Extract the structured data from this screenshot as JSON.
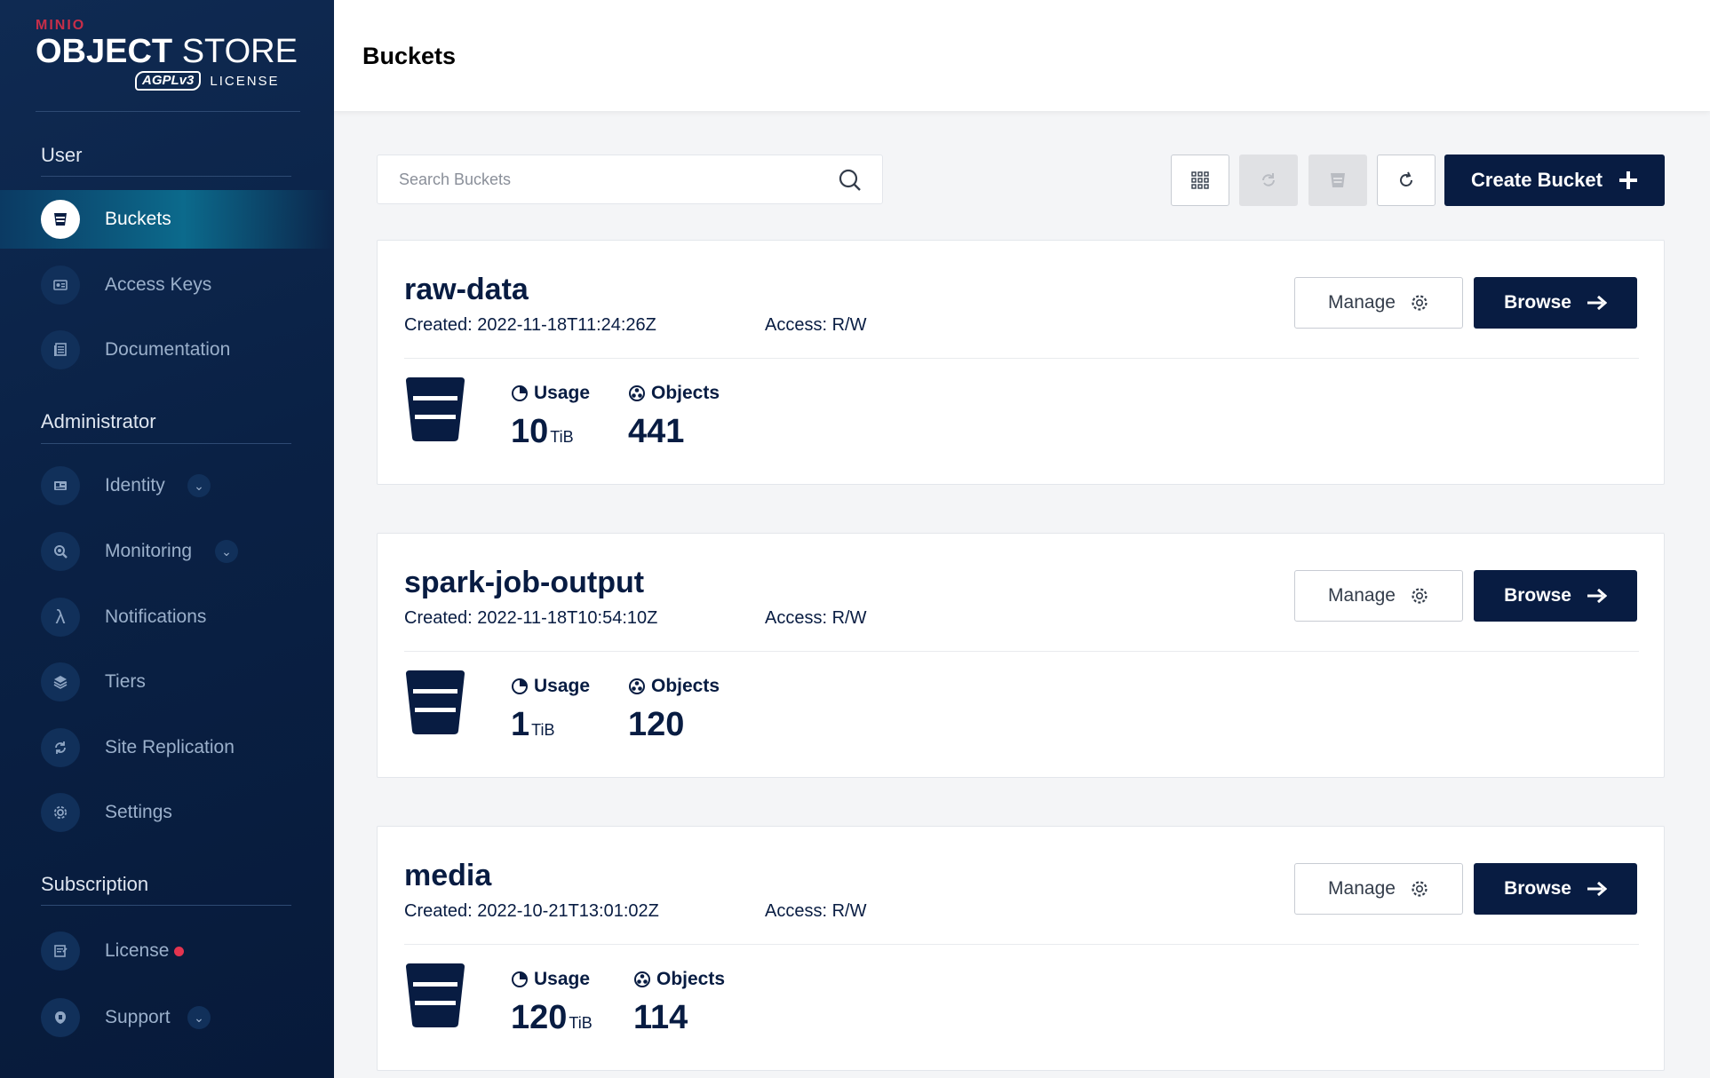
{
  "sidebar": {
    "logo": {
      "brand": "MINIO",
      "product_bold": "OBJECT",
      "product_light": "STORE",
      "license_badge": "AGPLv3",
      "license_text": "LICENSE"
    },
    "sections": {
      "user": "User",
      "administrator": "Administrator",
      "subscription": "Subscription"
    },
    "items": [
      {
        "label": "Buckets",
        "icon": "bucket-icon",
        "active": true
      },
      {
        "label": "Access Keys",
        "icon": "key-card-icon"
      },
      {
        "label": "Documentation",
        "icon": "document-icon"
      },
      {
        "label": "Identity",
        "icon": "id-card-icon",
        "expandable": true
      },
      {
        "label": "Monitoring",
        "icon": "magnify-icon",
        "expandable": true
      },
      {
        "label": "Notifications",
        "icon": "lambda-icon"
      },
      {
        "label": "Tiers",
        "icon": "layers-icon"
      },
      {
        "label": "Site Replication",
        "icon": "replication-icon"
      },
      {
        "label": "Settings",
        "icon": "gear-icon"
      },
      {
        "label": "License",
        "icon": "license-icon",
        "badge": "red-dot"
      },
      {
        "label": "Support",
        "icon": "support-icon",
        "expandable": true
      }
    ]
  },
  "header": {
    "title": "Buckets"
  },
  "toolbar": {
    "search_placeholder": "Search Buckets",
    "create_label": "Create Bucket"
  },
  "buckets": [
    {
      "name": "raw-data",
      "created": "Created: 2022-11-18T11:24:26Z",
      "access": "Access: R/W",
      "usage_label": "Usage",
      "usage_value": "10",
      "usage_unit": "TiB",
      "objects_label": "Objects",
      "objects_value": "441",
      "manage_label": "Manage",
      "browse_label": "Browse"
    },
    {
      "name": "spark-job-output",
      "created": "Created: 2022-11-18T10:54:10Z",
      "access": "Access: R/W",
      "usage_label": "Usage",
      "usage_value": "1",
      "usage_unit": "TiB",
      "objects_label": "Objects",
      "objects_value": "120",
      "manage_label": "Manage",
      "browse_label": "Browse"
    },
    {
      "name": "media",
      "created": "Created: 2022-10-21T13:01:02Z",
      "access": "Access: R/W",
      "usage_label": "Usage",
      "usage_value": "120",
      "usage_unit": "TiB",
      "objects_label": "Objects",
      "objects_value": "114",
      "manage_label": "Manage",
      "browse_label": "Browse"
    }
  ],
  "colors": {
    "primary": "#081c42",
    "sidebar": "#0a2145",
    "accent_red": "#c72e49",
    "dot": "#e3344f"
  }
}
